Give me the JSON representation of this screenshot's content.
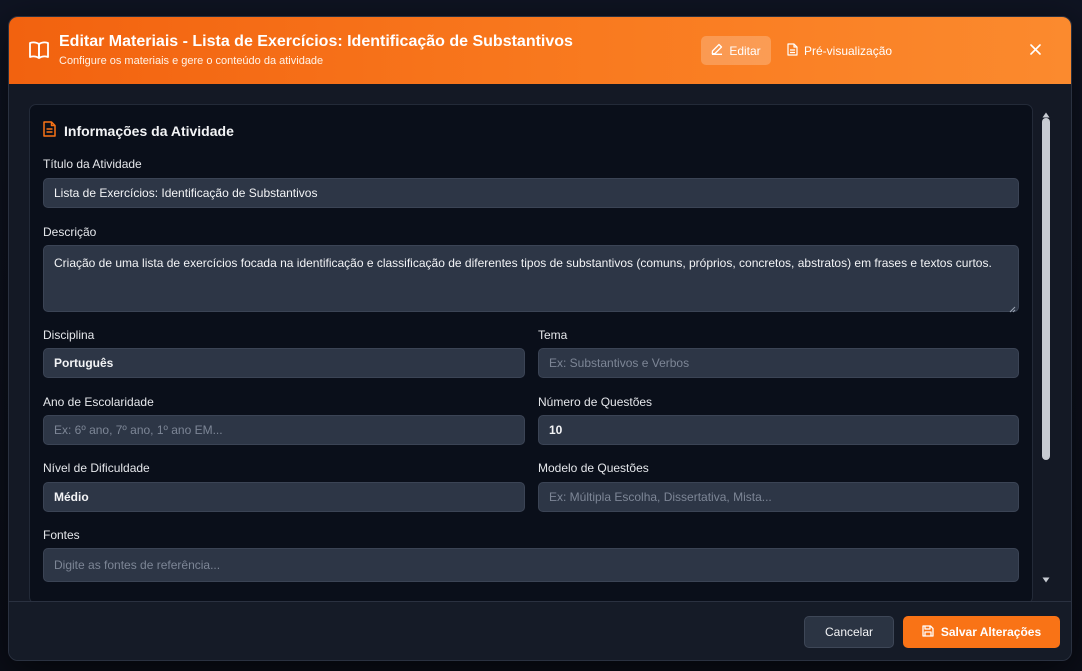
{
  "header": {
    "title": "Editar Materiais - Lista de Exercícios: Identificação de Substantivos",
    "subtitle": "Configure os materiais e gere o conteúdo da atividade",
    "edit_label": "Editar",
    "preview_label": "Pré-visualização",
    "icons": {
      "title": "book-open-icon",
      "edit": "pencil-icon",
      "preview": "file-text-icon",
      "close": "close-icon"
    }
  },
  "section": {
    "title": "Informações da Atividade",
    "icon": "file-text-icon"
  },
  "fields": {
    "titulo": {
      "label": "Título da Atividade",
      "value": "Lista de Exercícios: Identificação de Substantivos",
      "placeholder": ""
    },
    "descricao": {
      "label": "Descrição",
      "value": "Criação de uma lista de exercícios focada na identificação e classificação de diferentes tipos de substantivos (comuns, próprios, concretos, abstratos) em frases e textos curtos.",
      "placeholder": ""
    },
    "disciplina": {
      "label": "Disciplina",
      "value": "Português",
      "placeholder": ""
    },
    "tema": {
      "label": "Tema",
      "value": "",
      "placeholder": "Ex: Substantivos e Verbos"
    },
    "ano": {
      "label": "Ano de Escolaridade",
      "value": "",
      "placeholder": "Ex: 6º ano, 7º ano, 1º ano EM..."
    },
    "numero": {
      "label": "Número de Questões",
      "value": "10",
      "placeholder": ""
    },
    "nivel": {
      "label": "Nível de Dificuldade",
      "value": "Médio",
      "placeholder": ""
    },
    "modelo": {
      "label": "Modelo de Questões",
      "value": "",
      "placeholder": "Ex: Múltipla Escolha, Dissertativa, Mista..."
    },
    "fontes": {
      "label": "Fontes",
      "value": "",
      "placeholder": "Digite as fontes de referência..."
    }
  },
  "footer": {
    "cancel_label": "Cancelar",
    "save_label": "Salvar Alterações",
    "save_icon": "save-icon"
  },
  "colors": {
    "accent": "#f97316",
    "header_gradient_start": "#f2620f",
    "header_gradient_end": "#fb8a2e",
    "surface": "#151b27",
    "card": "#0a0f1a",
    "input": "#2d3646"
  }
}
